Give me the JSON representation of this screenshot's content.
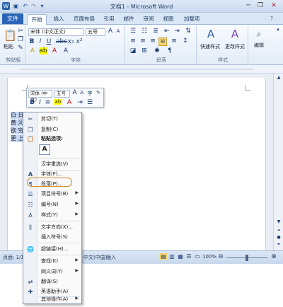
{
  "window": {
    "title": "文档1 - Microsoft Word",
    "help_glyph": "?",
    "minimize_glyph": "─",
    "restore_glyph": "❐",
    "close_glyph": "✕"
  },
  "tabs": {
    "file": "文件",
    "items": [
      "开始",
      "插入",
      "页面布局",
      "引用",
      "邮件",
      "审阅",
      "视图",
      "加载项"
    ]
  },
  "ribbon": {
    "clipboard": {
      "label": "剪贴板",
      "paste": "粘贴"
    },
    "font": {
      "label": "字体",
      "name": "宋体 (中文正文)",
      "size": "五号"
    },
    "paragraph": {
      "label": "段落"
    },
    "styles": {
      "label": "样式",
      "quick": "快速样式",
      "change": "更改样式"
    },
    "editing": {
      "label": "编辑"
    }
  },
  "doc": {
    "lines": [
      "白 日",
      "黄 河",
      "欲 穷",
      "更 上"
    ]
  },
  "mini_toolbar": {
    "font": "宋体 (中文)",
    "size": "五号"
  },
  "context_menu": {
    "cut": "剪切(T)",
    "copy": "复制(C)",
    "paste_options": "粘贴选项:",
    "paste_a": "A",
    "hanzi": "汉字重选(V)",
    "font": "字体(F)...",
    "paragraph": "段落(P)...",
    "bullets": "项目符号(B)",
    "numbering": "编号(N)",
    "styles": "样式(Y)",
    "text_direction": "文字方向(X)...",
    "insert_symbol": "插入符号(S)",
    "hyperlink": "超链接(H)...",
    "lookup": "查找(K)",
    "synonym": "同义词(Y)",
    "translate": "翻译(S)",
    "english_assistant": "英语助手(A)",
    "other": "其他操作(A)"
  },
  "status": {
    "page": "页面: 1/1",
    "lang": "中文(中国)",
    "insert": "插入",
    "zoom": "100%"
  }
}
